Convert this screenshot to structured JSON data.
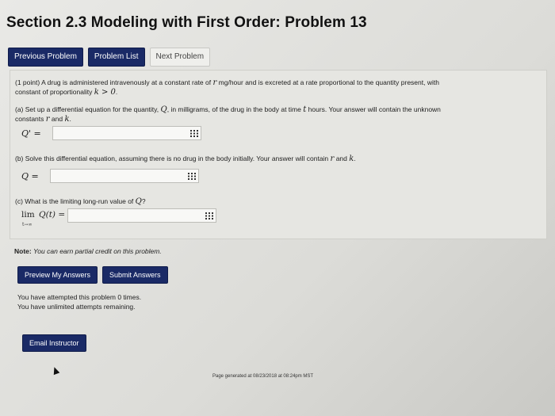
{
  "title": "Section 2.3 Modeling with First Order: Problem 13",
  "nav": {
    "previous": "Previous Problem",
    "list": "Problem List",
    "next": "Next Problem"
  },
  "problem": {
    "intro_line1_a": "(1 point) A drug is administered intravenously at a constant rate of",
    "intro_var_r": "r",
    "intro_line1_b": "mg/hour and is excreted at a rate proportional to the quantity present, with",
    "intro_line2_a": "constant of proportionality",
    "intro_line2_math": "k > 0",
    "intro_line2_b": ".",
    "part_a_line1": "(a) Set up a differential equation for the quantity,",
    "part_a_var_Q": "Q",
    "part_a_line1_b": ", in milligrams, of the drug in the body at time",
    "part_a_var_t": "t",
    "part_a_line1_c": "hours. Your answer will contain the unknown",
    "part_a_line2": "constants",
    "part_a_line2_r": "r",
    "part_a_line2_and": "and",
    "part_a_line2_k": "k",
    "part_a_line2_end": ".",
    "part_a_label": "Q' =",
    "part_a_value": "",
    "part_b_line": "(b) Solve this differential equation, assuming there is no drug in the body initially. Your answer will contain",
    "part_b_r": "r",
    "part_b_and": "and",
    "part_b_k": "k",
    "part_b_end": ".",
    "part_b_label": "Q =",
    "part_b_value": "",
    "part_c_line": "(c) What is the limiting long-run value of",
    "part_c_var": "Q",
    "part_c_end": "?",
    "part_c_lim": "lim",
    "part_c_func": "Q(t) =",
    "part_c_sub": "t→∞",
    "part_c_value": ""
  },
  "note": {
    "label": "Note:",
    "text": "You can earn partial credit on this problem."
  },
  "actions": {
    "preview": "Preview My Answers",
    "submit": "Submit Answers"
  },
  "attempts": {
    "line1": "You have attempted this problem 0 times.",
    "line2": "You have unlimited attempts remaining."
  },
  "email": "Email Instructor",
  "footer": "Page generated at 08/23/2018 at 08:24pm MST",
  "colors": {
    "accent": "#1a2a66",
    "background": "#d9d9d6"
  },
  "icons": {
    "equation_editor": "grid-icon"
  }
}
